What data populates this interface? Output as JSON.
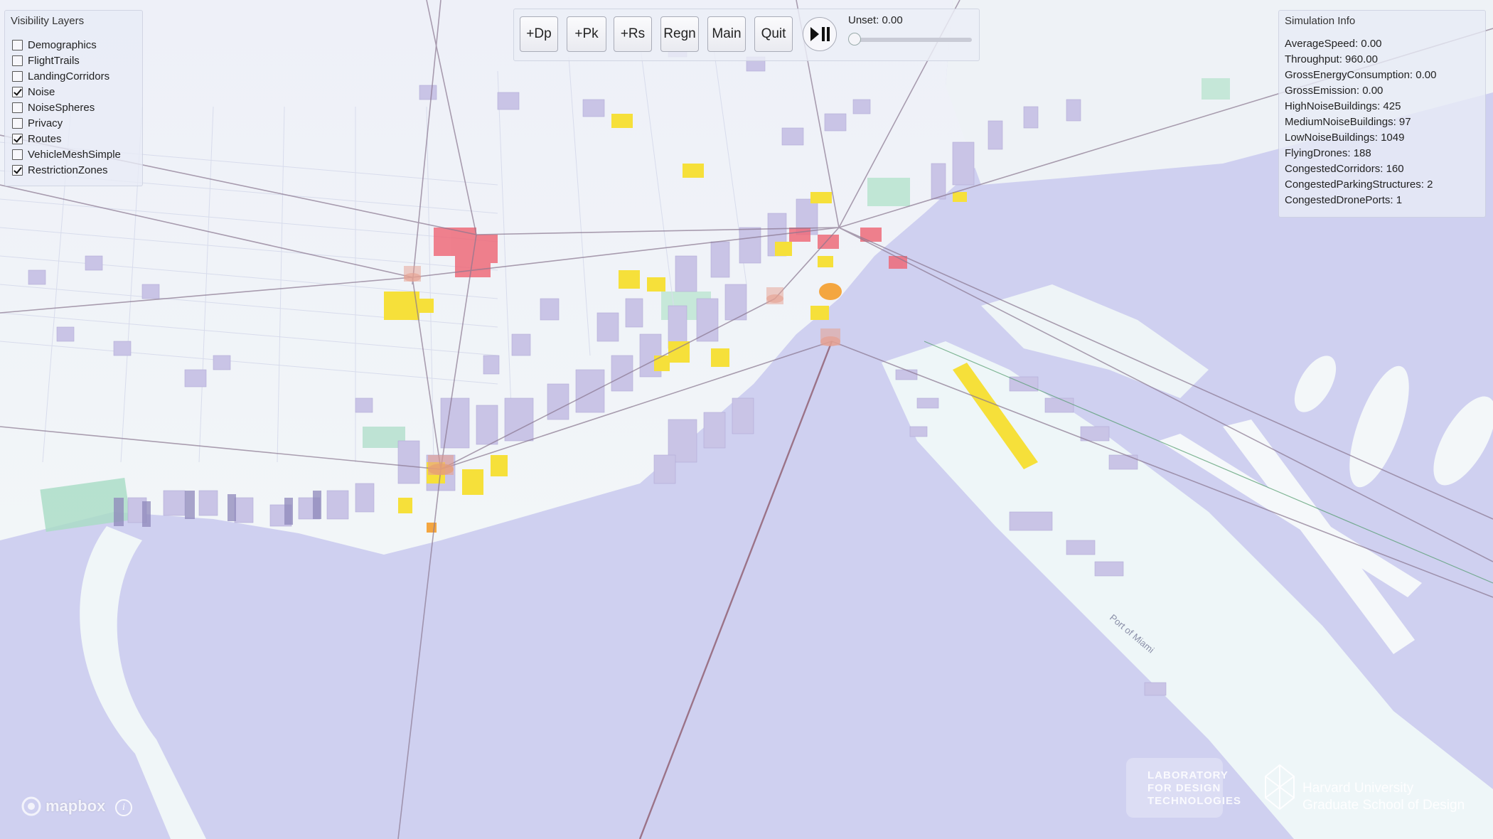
{
  "layers_panel": {
    "title": "Visibility Layers",
    "items": [
      {
        "label": "Demographics",
        "checked": false
      },
      {
        "label": "FlightTrails",
        "checked": false
      },
      {
        "label": "LandingCorridors",
        "checked": false
      },
      {
        "label": "Noise",
        "checked": true
      },
      {
        "label": "NoiseSpheres",
        "checked": false
      },
      {
        "label": "Privacy",
        "checked": false
      },
      {
        "label": "Routes",
        "checked": true
      },
      {
        "label": "VehicleMeshSimple",
        "checked": false
      },
      {
        "label": "RestrictionZones",
        "checked": true
      }
    ]
  },
  "toolbar": {
    "buttons": [
      "+Dp",
      "+Pk",
      "+Rs",
      "Regn",
      "Main",
      "Quit"
    ],
    "play_icon": "play-pause-icon",
    "unset_label": "Unset: 0.00",
    "slider_value": 0.0
  },
  "sim_panel": {
    "title": "Simulation Info",
    "rows": [
      "AverageSpeed: 0.00",
      "Throughput: 960.00",
      "GrossEnergyConsumption: 0.00",
      "GrossEmission: 0.00",
      "HighNoiseBuildings: 425",
      "MediumNoiseBuildings: 97",
      "LowNoiseBuildings: 1049",
      "FlyingDrones: 188",
      "CongestedCorridors: 160",
      "CongestedParkingStructures: 2",
      "CongestedDronePorts: 1"
    ]
  },
  "attribution": {
    "mapbox": "mapbox",
    "ldt_lines": [
      "LABORATORY",
      "FOR DESIGN",
      "TECHNOLOGIES"
    ],
    "harvard_lines": [
      "Harvard University",
      "Graduate School of Design"
    ]
  },
  "map_labels": {
    "port": "Port of Miami"
  },
  "colors": {
    "water": "#cfd0f0",
    "land": "#eef4f6",
    "park": "#a8dcc4",
    "building": "#c9c4e6",
    "noise_high": "#ee6b7a",
    "noise_medium": "#f4a640",
    "noise_low": "#f6e03a",
    "route": "#8a7790"
  }
}
